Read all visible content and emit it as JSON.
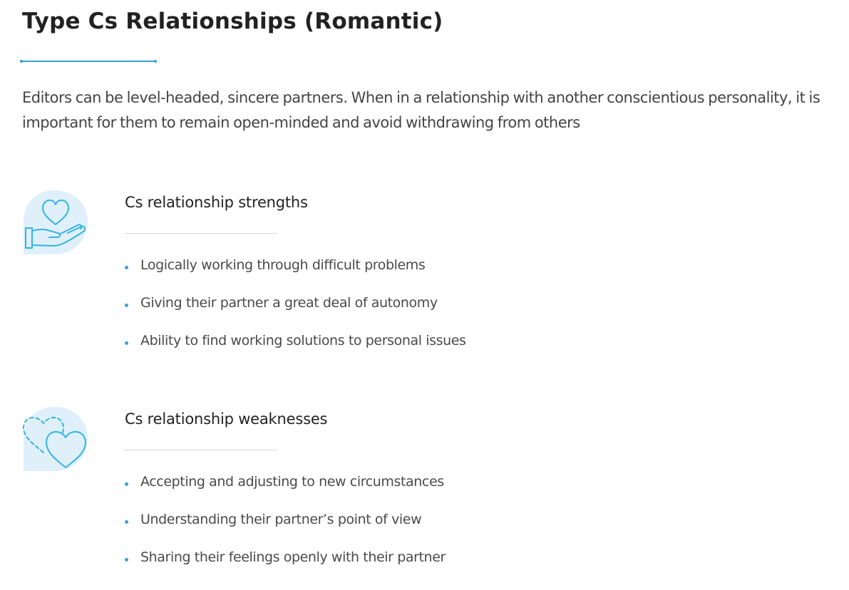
{
  "page": {
    "title": "Type Cs Relationships (Romantic)",
    "intro": "Editors can be level-headed, sincere partners. When in a relationship with another conscientious personality, it is important for them to remain open-minded and avoid withdrawing from others"
  },
  "strengths": {
    "icon": "heart-in-hand-icon",
    "title": "Cs relationship strengths",
    "items": [
      "Logically working through difficult problems",
      "Giving their partner a great deal of autonomy",
      "Ability to find working solutions to personal issues"
    ]
  },
  "weaknesses": {
    "icon": "broken-hearts-icon",
    "title": "Cs relationship weaknesses",
    "items": [
      "Accepting and adjusting to new circumstances",
      "Understanding their partner’s point of view",
      "Sharing their feelings openly with their partner"
    ]
  },
  "colors": {
    "accent": "#3a9fd8",
    "icon_bg": "#dff0fa",
    "icon_stroke": "#35b3e0"
  }
}
